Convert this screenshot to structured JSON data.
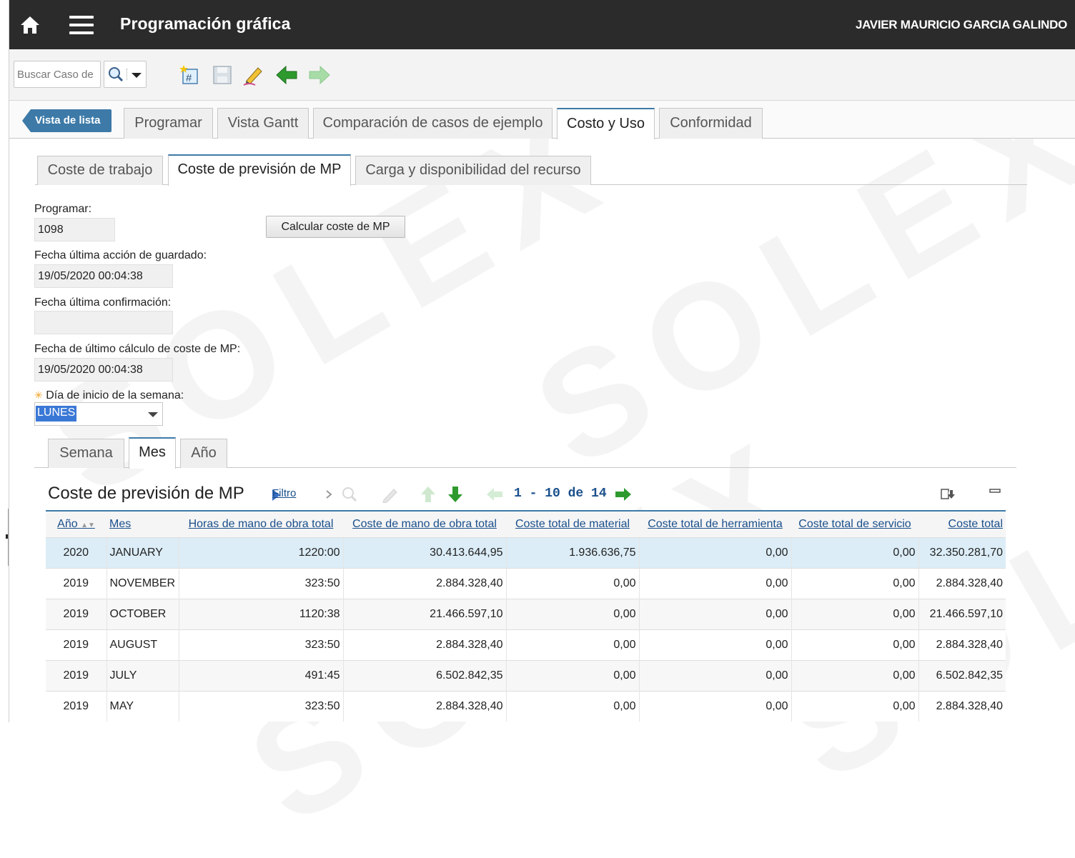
{
  "header": {
    "title": "Programación gráfica",
    "user": "JAVIER MAURICIO GARCIA GALINDO"
  },
  "toolbar": {
    "search_placeholder": "Buscar Caso de"
  },
  "main_tabs": {
    "back": "Vista de lista",
    "items": [
      "Programar",
      "Vista Gantt",
      "Comparación de casos de ejemplo",
      "Costo y Uso",
      "Conformidad"
    ],
    "active": "Costo y Uso"
  },
  "sub_tabs": {
    "items": [
      "Coste de trabajo",
      "Coste de previsión de MP",
      "Carga y disponibilidad del recurso"
    ],
    "active": "Coste de previsión de MP"
  },
  "form": {
    "programar_label": "Programar:",
    "programar_value": "1098",
    "calc_button": "Calcular coste de MP",
    "last_save_label": "Fecha última acción de guardado:",
    "last_save_value": "19/05/2020 00:04:38",
    "last_confirm_label": "Fecha última confirmación:",
    "last_confirm_value": "",
    "last_calc_label": "Fecha de último cálculo de coste de MP:",
    "last_calc_value": "19/05/2020 00:04:38",
    "week_start_label": "Día de inicio de la semana:",
    "week_start_value": "LUNES"
  },
  "period_tabs": {
    "items": [
      "Semana",
      "Mes",
      "Año"
    ],
    "active": "Mes"
  },
  "table": {
    "title": "Coste de previsión de MP",
    "filter": "Filtro",
    "pager": "1 - 10 de 14",
    "columns": [
      "Año",
      "Mes",
      "Horas de mano de obra total",
      "Coste de mano de obra total",
      "Coste total de material",
      "Coste total de herramienta",
      "Coste total de servicio",
      "Coste total"
    ],
    "rows": [
      [
        "2020",
        "JANUARY",
        "1220:00",
        "30.413.644,95",
        "1.936.636,75",
        "0,00",
        "0,00",
        "32.350.281,70"
      ],
      [
        "2019",
        "NOVEMBER",
        "323:50",
        "2.884.328,40",
        "0,00",
        "0,00",
        "0,00",
        "2.884.328,40"
      ],
      [
        "2019",
        "OCTOBER",
        "1120:38",
        "21.466.597,10",
        "0,00",
        "0,00",
        "0,00",
        "21.466.597,10"
      ],
      [
        "2019",
        "AUGUST",
        "323:50",
        "2.884.328,40",
        "0,00",
        "0,00",
        "0,00",
        "2.884.328,40"
      ],
      [
        "2019",
        "JULY",
        "491:45",
        "6.502.842,35",
        "0,00",
        "0,00",
        "0,00",
        "6.502.842,35"
      ],
      [
        "2019",
        "MAY",
        "323:50",
        "2.884.328,40",
        "0,00",
        "0,00",
        "0,00",
        "2.884.328,40"
      ]
    ]
  },
  "watermark": "SOLEX",
  "colors": {
    "header_bg": "#2b2b2b",
    "accent": "#3d7aa8",
    "link": "#1a4f8b",
    "selected_row": "#dcedf7",
    "arrow_green": "#2e9a2e"
  }
}
